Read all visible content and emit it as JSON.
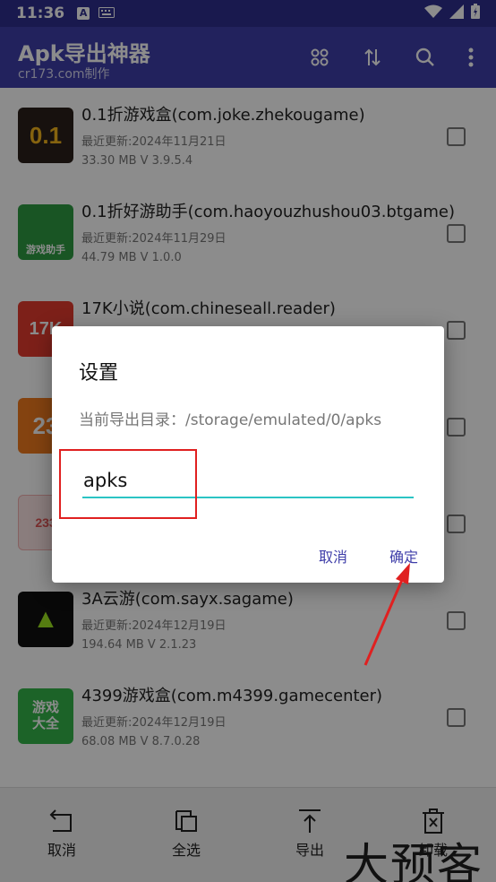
{
  "status_bar": {
    "time": "11:36"
  },
  "app_bar": {
    "title": "Apk导出神器",
    "subtitle": "cr173.com制作"
  },
  "apps": [
    {
      "name": "0.1折游戏盒(com.joke.zhekougame)",
      "updated": "最近更新:2024年11月21日",
      "meta": "33.30 MB   V 3.9.5.4",
      "icon_label": "0.1",
      "icon_color": "#2a1f1a"
    },
    {
      "name": "0.1折好游助手(com.haoyouzhushou03.btgame)",
      "updated": "最近更新:2024年11月29日",
      "meta": "44.79 MB   V 1.0.0",
      "icon_label": "游戏助手",
      "icon_color": "#2e9c43"
    },
    {
      "name": "17K小说(com.chineseall.reader)",
      "updated": "",
      "meta": "",
      "icon_label": "17K",
      "icon_color": "#e43b2e"
    },
    {
      "name": "",
      "updated": "",
      "meta": "",
      "icon_label": "23",
      "icon_color": "#f07a1e"
    },
    {
      "name": "",
      "updated": "",
      "meta": "",
      "icon_label": "233",
      "icon_color": "#f7c6c6"
    },
    {
      "name": "3A云游(com.sayx.sagame)",
      "updated": "最近更新:2024年12月19日",
      "meta": "194.64 MB   V 2.1.23",
      "icon_label": "▲",
      "icon_color": "#0f0f0f"
    },
    {
      "name": "4399游戏盒(com.m4399.gamecenter)",
      "updated": "最近更新:2024年12月19日",
      "meta": "68.08 MB   V 8.7.0.28",
      "icon_label": "游戏大全",
      "icon_color": "#34b44a"
    }
  ],
  "bottom_bar": {
    "cancel": "取消",
    "select_all": "全选",
    "export": "导出",
    "uninstall": "卸载"
  },
  "dialog": {
    "title": "设置",
    "current_dir": "当前导出目录：/storage/emulated/0/apks",
    "input_value": "apks",
    "cancel": "取消",
    "confirm": "确定"
  },
  "watermark": "大预客",
  "colors": {
    "primary": "#3f3ea9",
    "status": "#2f2e8f",
    "accent": "#2bc4c4",
    "annotation": "#e02020"
  }
}
